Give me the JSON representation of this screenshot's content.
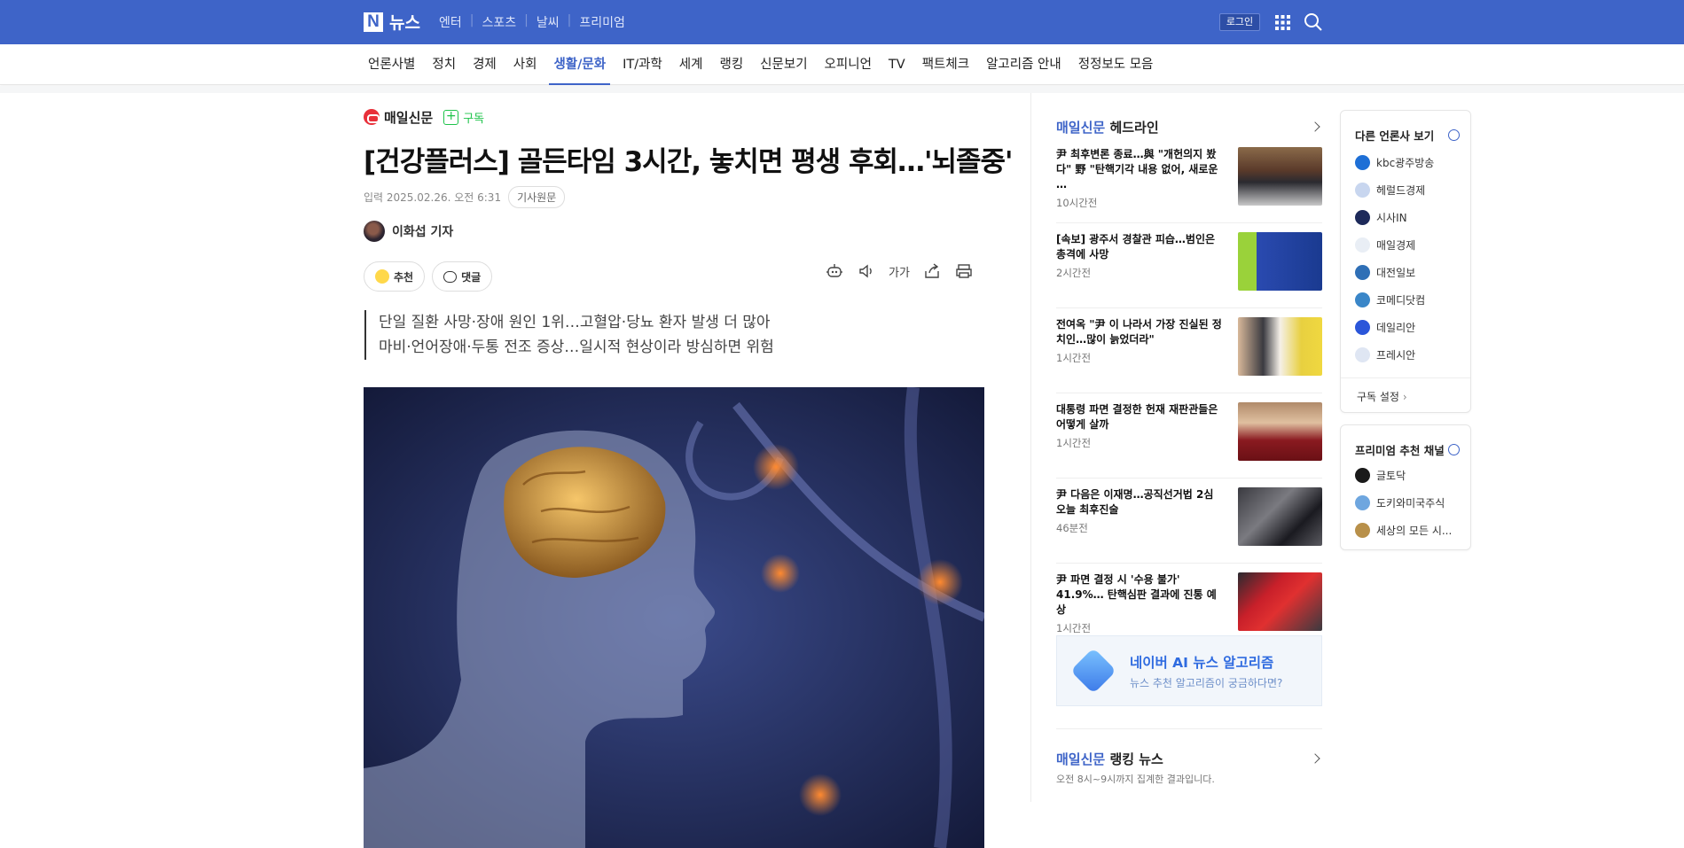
{
  "topbar": {
    "logo_letter": "N",
    "logo_text": "뉴스",
    "services": [
      "엔터",
      "스포츠",
      "날씨",
      "프리미엄"
    ],
    "login": "로그인"
  },
  "nav": [
    "언론사별",
    "정치",
    "경제",
    "사회",
    "생활/문화",
    "IT/과학",
    "세계",
    "랭킹",
    "신문보기",
    "오피니언",
    "TV",
    "팩트체크",
    "알고리즘 안내",
    "정정보도 모음"
  ],
  "article": {
    "press": "매일신문",
    "subscribe": "구독",
    "title": "[건강플러스] 골든타임 3시간, 놓치면 평생 후회…'뇌졸중'",
    "date": "입력 2025.02.26. 오전 6:31",
    "original": "기사원문",
    "author": "이화섭 기자",
    "recommend": "추천",
    "comment": "댓글",
    "font_tool": "가가",
    "summary": [
      "단일 질환 사망·장애 원인 1위…고혈압·당뇨 환자 발생 더 많아",
      "마비·언어장애·두통 전조 증상…일시적 현상이라 방심하면 위험"
    ]
  },
  "headlines": {
    "press": "매일신문",
    "label": "헤드라인",
    "items": [
      {
        "title": "尹 최후변론 종료…與 \"개헌의지 봤다\" 野 \"탄핵기각 내용 없어, 새로운 …",
        "time": "10시간전"
      },
      {
        "title": "[속보] 광주서 경찰관 피습…범인은 총격에 사망",
        "time": "2시간전"
      },
      {
        "title": "전여옥 \"尹 이 나라서 가장 진실된 정치인…많이 늙었더라\"",
        "time": "1시간전"
      },
      {
        "title": "대통령 파면 결정한 헌재 재판관들은 어떻게 살까",
        "time": "1시간전"
      },
      {
        "title": "尹 다음은 이재명…공직선거법 2심 오늘 최후진술",
        "time": "46분전"
      },
      {
        "title": "尹 파면 결정 시 '수용 불가' 41.9%… 탄핵심판 결과에 진통 예상",
        "time": "1시간전"
      }
    ]
  },
  "ai_banner": {
    "title": "네이버 AI 뉴스 알고리즘",
    "subtitle": "뉴스 추천 알고리즘이 궁금하다면?"
  },
  "ranking": {
    "press": "매일신문",
    "label": "랭킹 뉴스",
    "subtitle": "오전 8시~9시까지 집계한 결과입니다."
  },
  "other_press": {
    "title": "다른 언론사 보기",
    "items": [
      {
        "name": "kbc광주방송",
        "color": "#1e6fd6"
      },
      {
        "name": "헤럴드경제",
        "color": "#c8d6ef"
      },
      {
        "name": "시사IN",
        "color": "#1d2a5a"
      },
      {
        "name": "매일경제",
        "color": "#e9eef5"
      },
      {
        "name": "대전일보",
        "color": "#2f6fb6"
      },
      {
        "name": "코메디닷컴",
        "color": "#3a86c8"
      },
      {
        "name": "데일리안",
        "color": "#2b56d9"
      },
      {
        "name": "프레시안",
        "color": "#dfe6f3"
      }
    ],
    "footer": "구독 설정"
  },
  "premium": {
    "title": "프리미엄 추천 채널",
    "items": [
      {
        "name": "글토닥",
        "color": "#1a1a1a"
      },
      {
        "name": "도키와미국주식",
        "color": "#6ea6df"
      },
      {
        "name": "세상의 모든 시...",
        "color": "#b8904a"
      }
    ]
  },
  "colors": {
    "brand": "#3e64c8",
    "accent_green": "#1ec34a"
  }
}
